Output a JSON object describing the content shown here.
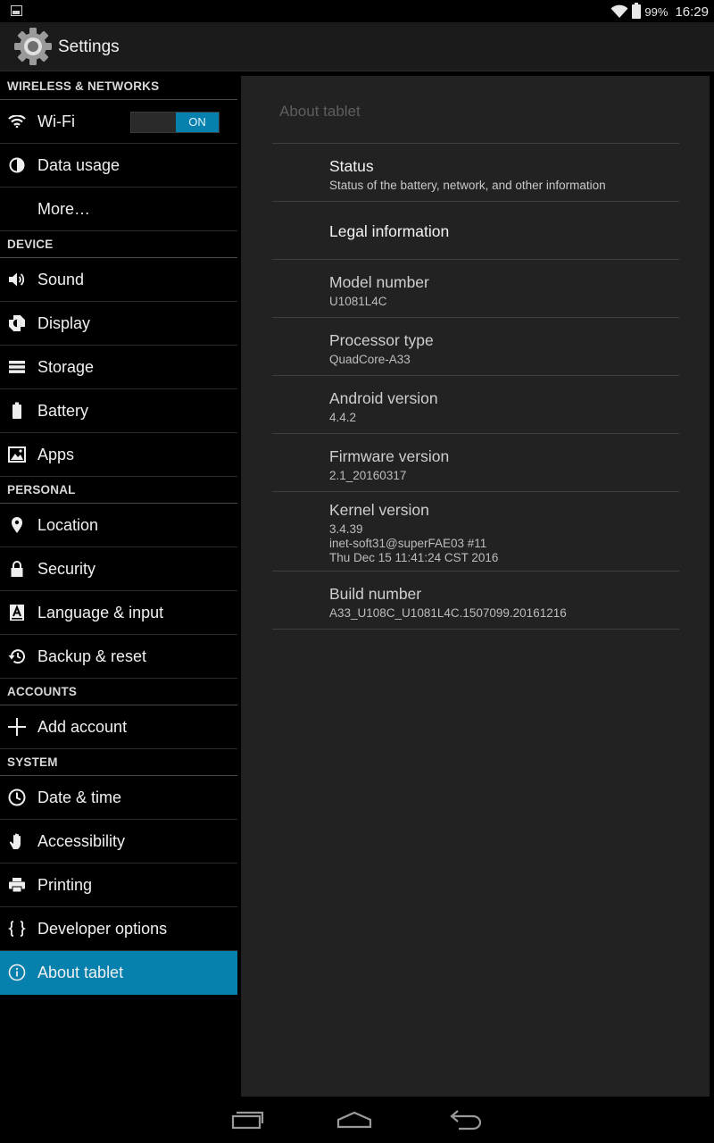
{
  "status_bar": {
    "battery_percent": "99%",
    "time": "16:29"
  },
  "action_bar": {
    "title": "Settings",
    "icon": "settings-gear-icon"
  },
  "sidebar": {
    "sections": [
      {
        "header": "WIRELESS & NETWORKS",
        "items": [
          {
            "label": "Wi-Fi",
            "icon": "wifi-icon",
            "toggle": "ON"
          },
          {
            "label": "Data usage",
            "icon": "data-usage-icon"
          },
          {
            "label": "More…",
            "icon": ""
          }
        ]
      },
      {
        "header": "DEVICE",
        "items": [
          {
            "label": "Sound",
            "icon": "sound-icon"
          },
          {
            "label": "Display",
            "icon": "display-icon"
          },
          {
            "label": "Storage",
            "icon": "storage-icon"
          },
          {
            "label": "Battery",
            "icon": "battery-icon"
          },
          {
            "label": "Apps",
            "icon": "apps-icon"
          }
        ]
      },
      {
        "header": "PERSONAL",
        "items": [
          {
            "label": "Location",
            "icon": "location-icon"
          },
          {
            "label": "Security",
            "icon": "lock-icon"
          },
          {
            "label": "Language & input",
            "icon": "language-icon"
          },
          {
            "label": "Backup & reset",
            "icon": "backup-icon"
          }
        ]
      },
      {
        "header": "ACCOUNTS",
        "items": [
          {
            "label": "Add account",
            "icon": "plus-icon"
          }
        ]
      },
      {
        "header": "SYSTEM",
        "items": [
          {
            "label": "Date & time",
            "icon": "clock-icon"
          },
          {
            "label": "Accessibility",
            "icon": "hand-icon"
          },
          {
            "label": "Printing",
            "icon": "printer-icon"
          },
          {
            "label": "Developer options",
            "icon": "braces-icon"
          },
          {
            "label": "About tablet",
            "icon": "info-icon",
            "selected": true
          }
        ]
      }
    ]
  },
  "detail": {
    "title": "About tablet",
    "items": [
      {
        "title": "Status",
        "subtitle": [
          "Status of the battery, network, and other information"
        ],
        "clickable": true
      },
      {
        "title": "Legal information",
        "subtitle": [],
        "clickable": true
      },
      {
        "title": "Model number",
        "subtitle": [
          "U1081L4C"
        ],
        "clickable": false
      },
      {
        "title": "Processor type",
        "subtitle": [
          "QuadCore-A33"
        ],
        "clickable": false
      },
      {
        "title": "Android version",
        "subtitle": [
          "4.4.2"
        ],
        "clickable": true
      },
      {
        "title": "Firmware version",
        "subtitle": [
          "2.1_20160317"
        ],
        "clickable": false
      },
      {
        "title": "Kernel version",
        "subtitle": [
          "3.4.39",
          "inet-soft31@superFAE03 #11",
          "Thu Dec 15 11:41:24 CST 2016"
        ],
        "clickable": false
      },
      {
        "title": "Build number",
        "subtitle": [
          "A33_U108C_U1081L4C.1507099.20161216"
        ],
        "clickable": true
      }
    ]
  },
  "nav_bar": {
    "buttons": [
      "recents-icon",
      "home-icon",
      "back-icon"
    ]
  }
}
